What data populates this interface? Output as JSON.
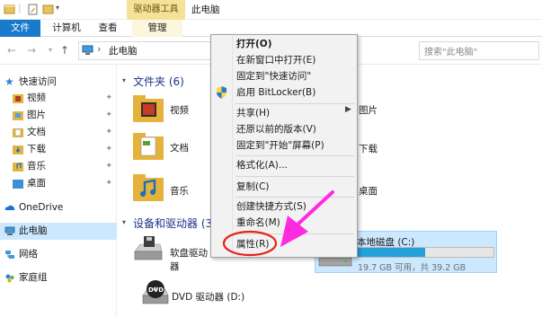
{
  "titlebar": {
    "drive_tools_tab": "驱动器工具",
    "window_title": "此电脑"
  },
  "ribbon": {
    "tabs": [
      "文件",
      "计算机",
      "查看",
      "管理"
    ]
  },
  "address": {
    "path": "此电脑",
    "separator": "›",
    "search_placeholder": "搜索\"此电脑\""
  },
  "sidebar": {
    "quick_access": "快速访问",
    "items": [
      "视频",
      "图片",
      "文档",
      "下载",
      "音乐",
      "桌面"
    ],
    "onedrive": "OneDrive",
    "this_pc": "此电脑",
    "network": "网络",
    "homegroup": "家庭组"
  },
  "main": {
    "folders_header": "文件夹 (6)",
    "folders": [
      "视频",
      "文档",
      "音乐",
      "图片",
      "下载",
      "桌面"
    ],
    "devices_header": "设备和驱动器 (3)",
    "devices_header_visible": "设备和驱动器 (3",
    "floppy_label": "软盘驱动器",
    "drive_c_label": "本地磁盘 (C:)",
    "drive_c_label_visible": "本地磁盘 (C:)",
    "drive_c_free": "19.7 GB 可用，共 39.2 GB",
    "drive_c_used_fraction": 0.497,
    "dvd_label": "DVD 驱动器 (D:)"
  },
  "context_menu": {
    "open": "打开(O)",
    "open_new_window": "在新窗口中打开(E)",
    "pin_quick_access": "固定到\"快速访问\"",
    "bitlocker": "启用 BitLocker(B)",
    "share": "共享(H)",
    "restore_previous": "还原以前的版本(V)",
    "pin_start": "固定到\"开始\"屏幕(P)",
    "format": "格式化(A)...",
    "copy": "复制(C)",
    "create_shortcut": "创建快捷方式(S)",
    "rename": "重命名(M)",
    "properties": "属性(R)",
    "submenu_arrow": "›"
  },
  "colors": {
    "accent": "#1979ca",
    "selection": "#cce8ff",
    "annotation": "#ff2be0",
    "highlight_ring": "#e8201c",
    "drive_tools": "#f4e19a"
  }
}
